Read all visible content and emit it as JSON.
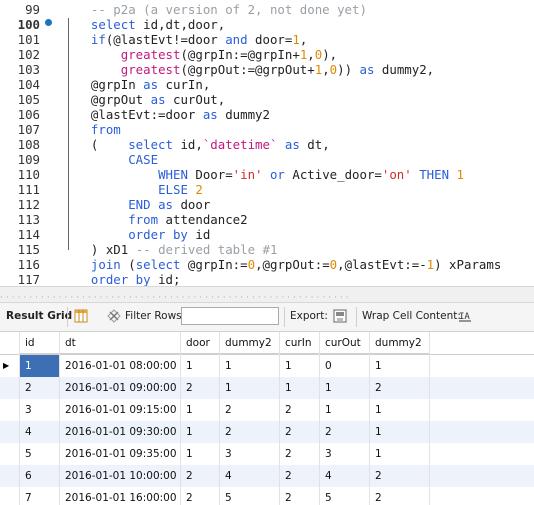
{
  "editor": {
    "lines": [
      {
        "n": "99",
        "t": [
          [
            "cm",
            "  -- p2a (a version of 2, not done yet)"
          ]
        ]
      },
      {
        "n": "100",
        "active": true,
        "t": [
          [
            "normal",
            "  "
          ],
          [
            "kw",
            "select"
          ],
          [
            "normal",
            " id,dt,door,"
          ]
        ]
      },
      {
        "n": "101",
        "t": [
          [
            "normal",
            "  "
          ],
          [
            "kw",
            "if"
          ],
          [
            "normal",
            "(@lastEvt!=door "
          ],
          [
            "kw",
            "and"
          ],
          [
            "normal",
            " door="
          ],
          [
            "num",
            "1"
          ],
          [
            "normal",
            ","
          ]
        ]
      },
      {
        "n": "102",
        "t": [
          [
            "normal",
            "      "
          ],
          [
            "fn",
            "greatest"
          ],
          [
            "normal",
            "(@grpIn:=@grpIn+"
          ],
          [
            "num",
            "1"
          ],
          [
            "normal",
            ","
          ],
          [
            "num",
            "0"
          ],
          [
            "normal",
            "),"
          ]
        ]
      },
      {
        "n": "103",
        "t": [
          [
            "normal",
            "      "
          ],
          [
            "fn",
            "greatest"
          ],
          [
            "normal",
            "(@grpOut:=@grpOut+"
          ],
          [
            "num",
            "1"
          ],
          [
            "normal",
            ","
          ],
          [
            "num",
            "0"
          ],
          [
            "normal",
            "))"
          ],
          [
            "kw",
            " as"
          ],
          [
            "normal",
            " dummy2,"
          ]
        ]
      },
      {
        "n": "104",
        "t": [
          [
            "normal",
            "  @grpIn "
          ],
          [
            "kw",
            "as"
          ],
          [
            "normal",
            " curIn,"
          ]
        ]
      },
      {
        "n": "105",
        "t": [
          [
            "normal",
            "  @grpOut "
          ],
          [
            "kw",
            "as"
          ],
          [
            "normal",
            " curOut,"
          ]
        ]
      },
      {
        "n": "106",
        "t": [
          [
            "normal",
            "  @lastEvt:=door "
          ],
          [
            "kw",
            "as"
          ],
          [
            "normal",
            " dummy2"
          ]
        ]
      },
      {
        "n": "107",
        "t": [
          [
            "normal",
            "  "
          ],
          [
            "kw",
            "from"
          ]
        ]
      },
      {
        "n": "108",
        "t": [
          [
            "normal",
            "  (    "
          ],
          [
            "kw",
            "select"
          ],
          [
            "normal",
            " id,"
          ],
          [
            "bt",
            "`datetime`"
          ],
          [
            "kw",
            " as"
          ],
          [
            "normal",
            " dt,"
          ]
        ]
      },
      {
        "n": "109",
        "t": [
          [
            "normal",
            "       "
          ],
          [
            "kw",
            "CASE"
          ]
        ]
      },
      {
        "n": "110",
        "t": [
          [
            "normal",
            "           "
          ],
          [
            "kw",
            "WHEN"
          ],
          [
            "normal",
            " Door="
          ],
          [
            "str",
            "'in'"
          ],
          [
            "kw",
            " or"
          ],
          [
            "normal",
            " Active_door="
          ],
          [
            "str",
            "'on'"
          ],
          [
            "kw",
            " THEN"
          ],
          [
            "num",
            " 1"
          ]
        ]
      },
      {
        "n": "111",
        "t": [
          [
            "normal",
            "           "
          ],
          [
            "kw",
            "ELSE"
          ],
          [
            "num",
            " 2"
          ]
        ]
      },
      {
        "n": "112",
        "t": [
          [
            "normal",
            "       "
          ],
          [
            "kw",
            "END"
          ],
          [
            "kw",
            " as"
          ],
          [
            "normal",
            " door"
          ]
        ]
      },
      {
        "n": "113",
        "t": [
          [
            "normal",
            "       "
          ],
          [
            "kw",
            "from"
          ],
          [
            "normal",
            " attendance2"
          ]
        ]
      },
      {
        "n": "114",
        "t": [
          [
            "normal",
            "       "
          ],
          [
            "kw",
            "order by"
          ],
          [
            "normal",
            " id"
          ]
        ]
      },
      {
        "n": "115",
        "t": [
          [
            "normal",
            "  ) xD1 "
          ],
          [
            "cm",
            "-- derived table #1"
          ]
        ]
      },
      {
        "n": "116",
        "t": [
          [
            "normal",
            "  "
          ],
          [
            "kw",
            "join"
          ],
          [
            "normal",
            " ("
          ],
          [
            "kw",
            "select"
          ],
          [
            "normal",
            " @grpIn:="
          ],
          [
            "num",
            "0"
          ],
          [
            "normal",
            ",@grpOut:="
          ],
          [
            "num",
            "0"
          ],
          [
            "normal",
            ",@lastEvt:=-"
          ],
          [
            "num",
            "1"
          ],
          [
            "normal",
            ") xParams"
          ]
        ]
      },
      {
        "n": "117",
        "t": [
          [
            "normal",
            "  "
          ],
          [
            "kw",
            "order by"
          ],
          [
            "normal",
            " id;"
          ]
        ]
      }
    ]
  },
  "toolbar": {
    "result_grid": "Result Grid",
    "filter_rows": "Filter Rows:",
    "filter_value": "",
    "export": "Export:",
    "wrap": "Wrap Cell Content:"
  },
  "grid": {
    "columns": [
      "id",
      "dt",
      "door",
      "dummy2",
      "curIn",
      "curOut",
      "dummy2"
    ],
    "rows": [
      [
        "1",
        "2016-01-01 08:00:00",
        "1",
        "1",
        "1",
        "0",
        "1"
      ],
      [
        "2",
        "2016-01-01 09:00:00",
        "2",
        "1",
        "1",
        "1",
        "2"
      ],
      [
        "3",
        "2016-01-01 09:15:00",
        "1",
        "2",
        "2",
        "1",
        "1"
      ],
      [
        "4",
        "2016-01-01 09:30:00",
        "1",
        "2",
        "2",
        "2",
        "1"
      ],
      [
        "5",
        "2016-01-01 09:35:00",
        "1",
        "3",
        "2",
        "3",
        "1"
      ],
      [
        "6",
        "2016-01-01 10:00:00",
        "2",
        "4",
        "2",
        "4",
        "2"
      ],
      [
        "7",
        "2016-01-01 16:00:00",
        "2",
        "5",
        "2",
        "5",
        "2"
      ]
    ]
  }
}
